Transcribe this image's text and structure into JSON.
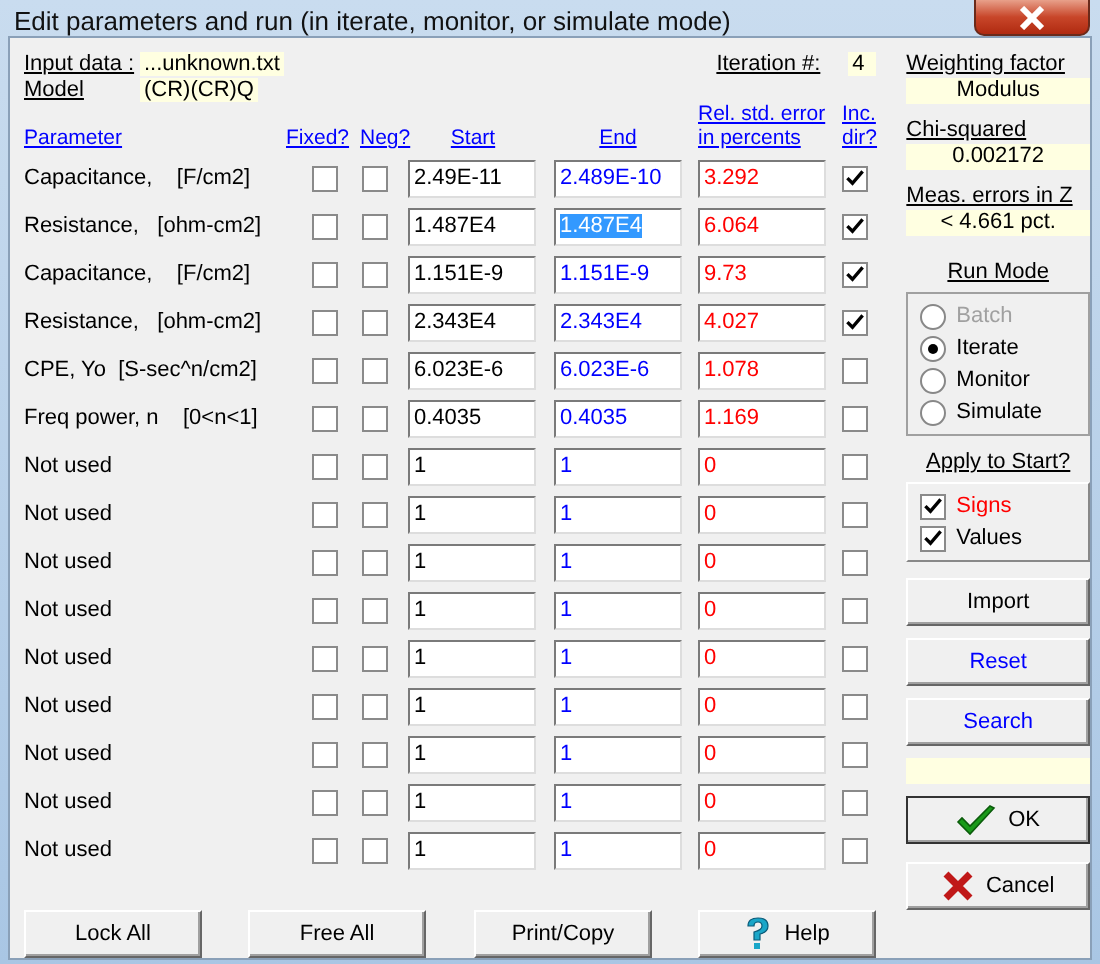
{
  "window": {
    "title": "Edit parameters and run (in iterate, monitor, or simulate mode)"
  },
  "info": {
    "input_label": "Input data :",
    "input_value": "...unknown.txt",
    "model_label": "Model",
    "model_value": "(CR)(CR)Q",
    "iteration_label": "Iteration #:",
    "iteration_value": "4"
  },
  "columns": {
    "parameter": "Parameter",
    "fixed": "Fixed?",
    "neg": "Neg?",
    "start": "Start",
    "end": "End",
    "error_1": "Rel. std. error",
    "error_2": "in percents",
    "inc_1": "Inc.",
    "inc_2": "dir?"
  },
  "rows": [
    {
      "name": "Capacitance,    [F/cm2]",
      "fixed": false,
      "neg": false,
      "start": "2.49E-11",
      "end": "2.489E-10",
      "end_selected": false,
      "error": "3.292",
      "inc_dir": true
    },
    {
      "name": "Resistance,   [ohm-cm2]",
      "fixed": false,
      "neg": false,
      "start": "1.487E4",
      "end": "1.487E4",
      "end_selected": true,
      "error": "6.064",
      "inc_dir": true
    },
    {
      "name": "Capacitance,    [F/cm2]",
      "fixed": false,
      "neg": false,
      "start": "1.151E-9",
      "end": "1.151E-9",
      "end_selected": false,
      "error": "9.73",
      "inc_dir": true
    },
    {
      "name": "Resistance,   [ohm-cm2]",
      "fixed": false,
      "neg": false,
      "start": "2.343E4",
      "end": "2.343E4",
      "end_selected": false,
      "error": "4.027",
      "inc_dir": true
    },
    {
      "name": "CPE, Yo  [S-sec^n/cm2]",
      "fixed": false,
      "neg": false,
      "start": "6.023E-6",
      "end": "6.023E-6",
      "end_selected": false,
      "error": "1.078",
      "inc_dir": false
    },
    {
      "name": "Freq power, n    [0<n<1]",
      "fixed": false,
      "neg": false,
      "start": "0.4035",
      "end": "0.4035",
      "end_selected": false,
      "error": "1.169",
      "inc_dir": false
    },
    {
      "name": "Not used",
      "fixed": false,
      "neg": false,
      "start": "1",
      "end": "1",
      "end_selected": false,
      "error": "0",
      "inc_dir": false
    },
    {
      "name": "Not used",
      "fixed": false,
      "neg": false,
      "start": "1",
      "end": "1",
      "end_selected": false,
      "error": "0",
      "inc_dir": false
    },
    {
      "name": "Not used",
      "fixed": false,
      "neg": false,
      "start": "1",
      "end": "1",
      "end_selected": false,
      "error": "0",
      "inc_dir": false
    },
    {
      "name": "Not used",
      "fixed": false,
      "neg": false,
      "start": "1",
      "end": "1",
      "end_selected": false,
      "error": "0",
      "inc_dir": false
    },
    {
      "name": "Not used",
      "fixed": false,
      "neg": false,
      "start": "1",
      "end": "1",
      "end_selected": false,
      "error": "0",
      "inc_dir": false
    },
    {
      "name": "Not used",
      "fixed": false,
      "neg": false,
      "start": "1",
      "end": "1",
      "end_selected": false,
      "error": "0",
      "inc_dir": false
    },
    {
      "name": "Not used",
      "fixed": false,
      "neg": false,
      "start": "1",
      "end": "1",
      "end_selected": false,
      "error": "0",
      "inc_dir": false
    },
    {
      "name": "Not used",
      "fixed": false,
      "neg": false,
      "start": "1",
      "end": "1",
      "end_selected": false,
      "error": "0",
      "inc_dir": false
    },
    {
      "name": "Not used",
      "fixed": false,
      "neg": false,
      "start": "1",
      "end": "1",
      "end_selected": false,
      "error": "0",
      "inc_dir": false
    }
  ],
  "side": {
    "weighting_label": "Weighting factor",
    "weighting_value": "Modulus",
    "chi_label": "Chi-squared",
    "chi_value": "0.002172",
    "meas_label": "Meas. errors in Z",
    "meas_value": "< 4.661 pct.",
    "run_mode_label": "Run Mode",
    "run_modes": [
      {
        "label": "Batch",
        "selected": false,
        "disabled": true
      },
      {
        "label": "Iterate",
        "selected": true,
        "disabled": false
      },
      {
        "label": "Monitor",
        "selected": false,
        "disabled": false
      },
      {
        "label": "Simulate",
        "selected": false,
        "disabled": false
      }
    ],
    "apply_label": "Apply to Start?",
    "apply": [
      {
        "label": "Signs",
        "checked": true,
        "kind": "warning"
      },
      {
        "label": "Values",
        "checked": true,
        "kind": "normal"
      }
    ],
    "import": "Import",
    "reset": "Reset",
    "search": "Search",
    "ok": "OK",
    "cancel": "Cancel"
  },
  "bottom_buttons": [
    {
      "label": "Lock All",
      "kind": "plain"
    },
    {
      "label": "Free All",
      "kind": "plain"
    },
    {
      "label": "Print/Copy",
      "kind": "plain"
    },
    {
      "label": "Help",
      "kind": "help"
    }
  ]
}
